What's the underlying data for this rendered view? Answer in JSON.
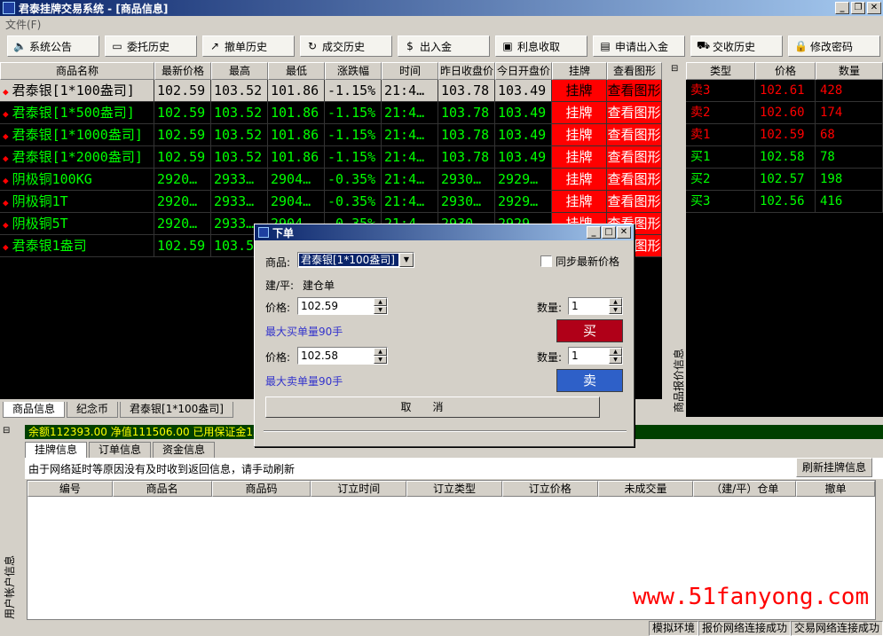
{
  "window": {
    "title": "君泰挂牌交易系统 - [商品信息]"
  },
  "menu": {
    "file": "文件(F)"
  },
  "toolbar": [
    {
      "label": "系统公告",
      "icon": "speaker-icon"
    },
    {
      "label": "委托历史",
      "icon": "monitor-icon"
    },
    {
      "label": "撤单历史",
      "icon": "share-icon"
    },
    {
      "label": "成交历史",
      "icon": "refresh-icon"
    },
    {
      "label": "出入金",
      "icon": "money-bag-icon"
    },
    {
      "label": "利息收取",
      "icon": "box-icon"
    },
    {
      "label": "申请出入金",
      "icon": "card-icon"
    },
    {
      "label": "交收历史",
      "icon": "truck-icon"
    },
    {
      "label": "修改密码",
      "icon": "lock-icon"
    }
  ],
  "quote_table": {
    "headers": [
      "商品名称",
      "最新价格",
      "最高",
      "最低",
      "涨跌幅",
      "时间",
      "昨日收盘价",
      "今日开盘价",
      "挂牌",
      "查看图形"
    ],
    "rows": [
      [
        "君泰银[1*100盎司]",
        "102.59",
        "103.52",
        "101.86",
        "-1.15%",
        "21:4…",
        "103.78",
        "103.49",
        "挂牌",
        "查看图形"
      ],
      [
        "君泰银[1*500盎司]",
        "102.59",
        "103.52",
        "101.86",
        "-1.15%",
        "21:4…",
        "103.78",
        "103.49",
        "挂牌",
        "查看图形"
      ],
      [
        "君泰银[1*1000盎司]",
        "102.59",
        "103.52",
        "101.86",
        "-1.15%",
        "21:4…",
        "103.78",
        "103.49",
        "挂牌",
        "查看图形"
      ],
      [
        "君泰银[1*2000盎司]",
        "102.59",
        "103.52",
        "101.86",
        "-1.15%",
        "21:4…",
        "103.78",
        "103.49",
        "挂牌",
        "查看图形"
      ],
      [
        "阴极铜100KG",
        "2920…",
        "2933…",
        "2904…",
        "-0.35%",
        "21:4…",
        "2930…",
        "2929…",
        "挂牌",
        "查看图形"
      ],
      [
        "阴极铜1T",
        "2920…",
        "2933…",
        "2904…",
        "-0.35%",
        "21:4…",
        "2930…",
        "2929…",
        "挂牌",
        "查看图形"
      ],
      [
        "阴极铜5T",
        "2920…",
        "2933…",
        "2904…",
        "-0.35%",
        "21:4…",
        "2930…",
        "2929…",
        "挂牌",
        "查看图形"
      ],
      [
        "君泰银1盎司",
        "102.59",
        "103.5",
        "",
        "",
        "",
        "",
        "",
        "挂牌",
        "查看图形"
      ]
    ]
  },
  "order_book": {
    "side_title": "商品报价信息",
    "headers": [
      "类型",
      "价格",
      "数量"
    ],
    "rows": [
      [
        "卖3",
        "102.61",
        "428"
      ],
      [
        "卖2",
        "102.60",
        "174"
      ],
      [
        "卖1",
        "102.59",
        "68"
      ],
      [
        "买1",
        "102.58",
        "78"
      ],
      [
        "买2",
        "102.57",
        "198"
      ],
      [
        "买3",
        "102.56",
        "416"
      ]
    ]
  },
  "bottom_tabs": [
    "商品信息",
    "纪念币",
    "君泰银[1*100盎司]"
  ],
  "account": {
    "side_title": "用户帐户信息",
    "balance_line": "余额112393.00   净值111506.00   已用保证金12",
    "tabs": [
      "挂牌信息",
      "订单信息",
      "资金信息"
    ],
    "notice": "由于网络延时等原因没有及时收到返回信息，请手动刷新",
    "refresh_label": "刷新挂牌信息",
    "grid_headers": [
      "编号",
      "商品名",
      "商品码",
      "订立时间",
      "订立类型",
      "订立价格",
      "未成交量",
      "（建/平）仓单",
      "撤单"
    ]
  },
  "status_bar": [
    "模拟环境",
    "报价网络连接成功",
    "交易网络连接成功"
  ],
  "watermark": "www.51fanyong.com",
  "dialog": {
    "title": "下单",
    "product_label": "商品:",
    "product_value": "君泰银[1*100盎司]",
    "sync_label": "同步最新价格",
    "mode_label": "建/平:",
    "mode_value": "建仓单",
    "buy_price_label": "价格:",
    "buy_price": "102.59",
    "buy_qty_label": "数量:",
    "buy_qty": "1",
    "max_buy": "最大买单量90手",
    "buy_label": "买",
    "sell_price_label": "价格:",
    "sell_price": "102.58",
    "sell_qty_label": "数量:",
    "sell_qty": "1",
    "max_sell": "最大卖单量90手",
    "sell_label": "卖",
    "cancel_label": "取消"
  },
  "colors": {
    "rise": "#ff0000",
    "fall": "#00ff00",
    "buy_button": "#b00018",
    "sell_button": "#2e60c8"
  }
}
